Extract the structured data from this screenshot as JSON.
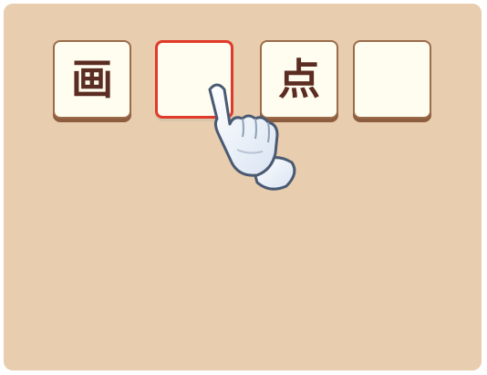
{
  "tiles": [
    {
      "char": "画",
      "selected": false
    },
    {
      "char": "",
      "selected": true
    },
    {
      "char": "点",
      "selected": false
    },
    {
      "char": "",
      "selected": false
    }
  ],
  "icons": {
    "pointer": "pointing-hand-icon"
  },
  "colors": {
    "board": "#e8cdae",
    "tile_fill": "#fffdf0",
    "tile_border": "#9a6c4a",
    "selected_border": "#e03a2a",
    "glyph": "#5b2d22"
  }
}
